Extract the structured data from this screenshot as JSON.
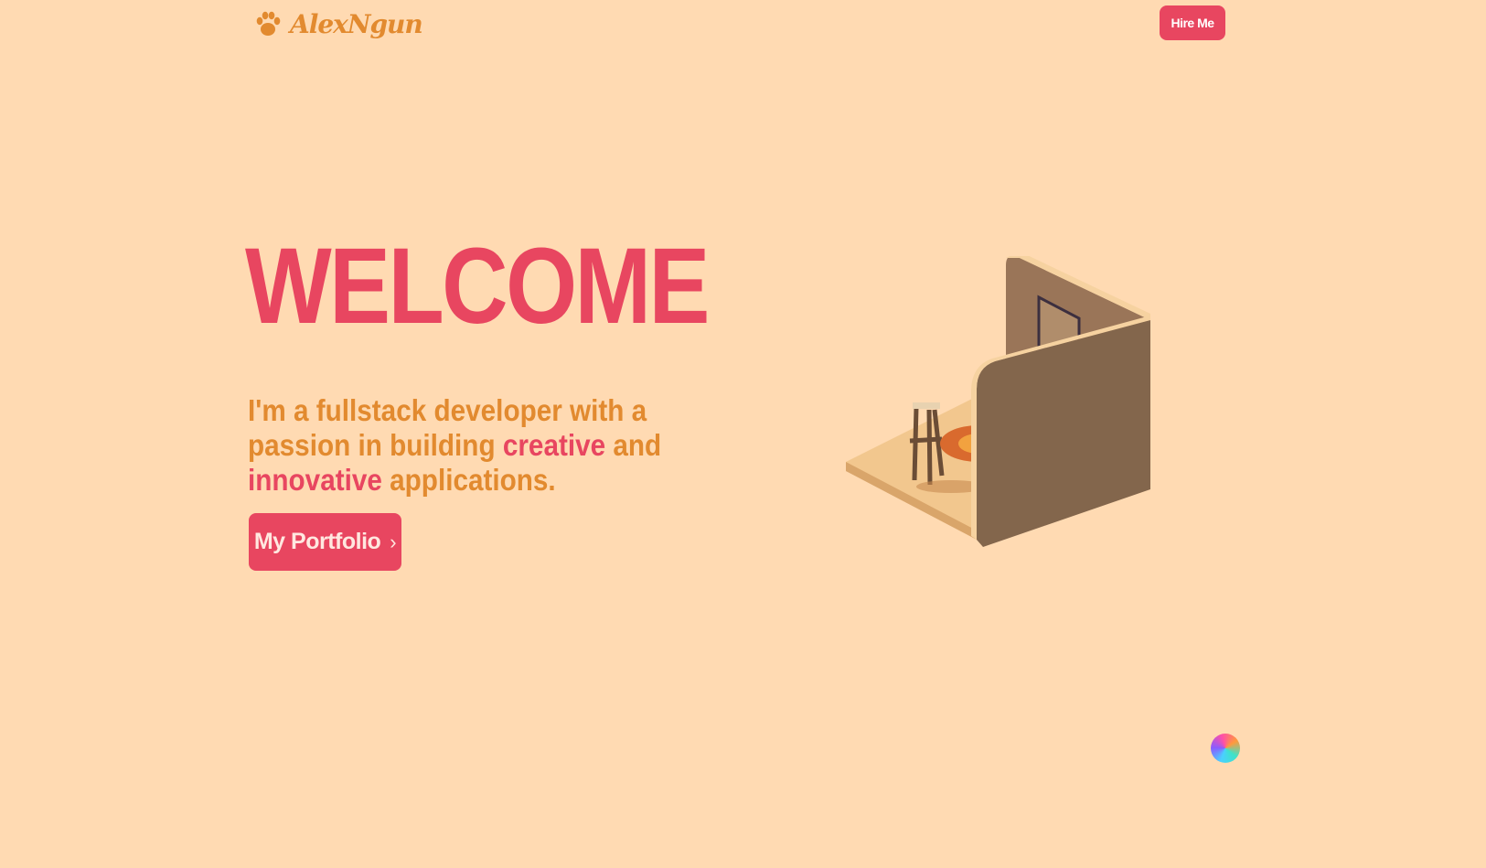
{
  "header": {
    "logo_text": "AlexNgun",
    "logo_icon": "paw-icon",
    "hire_label": "Hire Me"
  },
  "hero": {
    "title": "WELCOME",
    "desc_part1": "I'm a fullstack developer with a passion in building ",
    "desc_accent1": "creative",
    "desc_part2": " and ",
    "desc_accent2": "innovative",
    "desc_part3": " applications.",
    "portfolio_label": "My Portfolio",
    "portfolio_icon": "chevron-right-icon"
  },
  "colors": {
    "background": "#FFDAB2",
    "accent": "#E84660",
    "secondary": "#E28A2F"
  }
}
